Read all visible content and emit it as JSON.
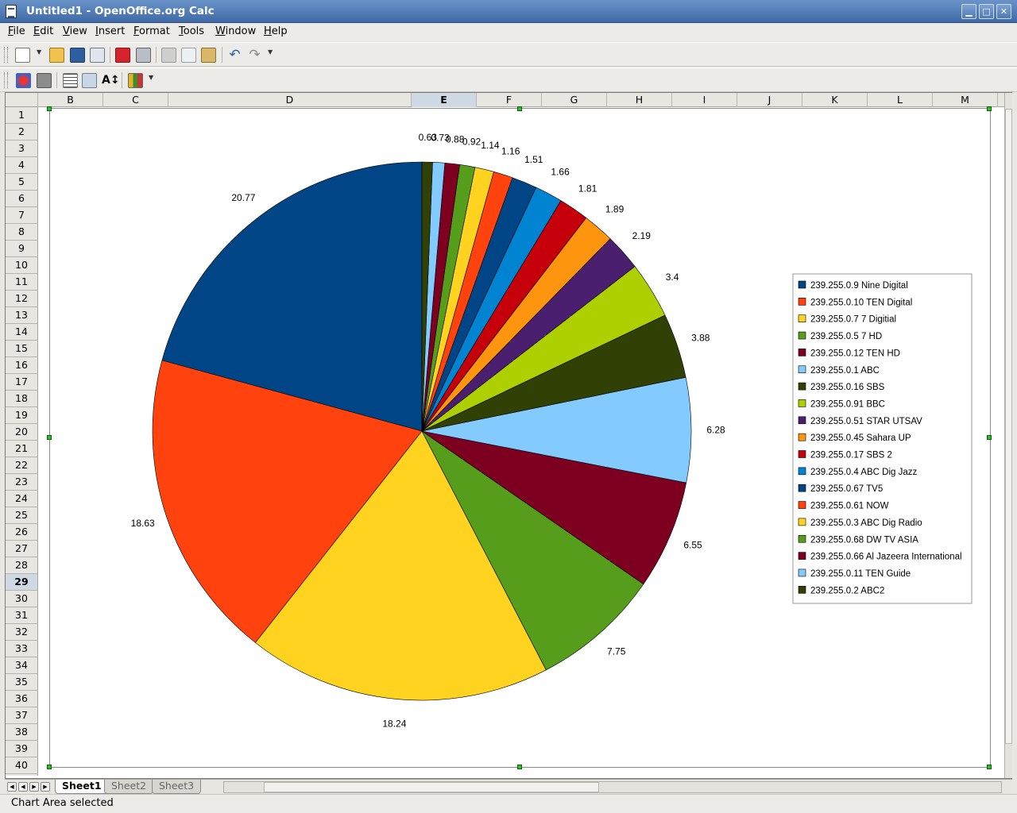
{
  "window": {
    "title": "Untitled1 - OpenOffice.org Calc",
    "minimize_glyph": "▁",
    "maximize_glyph": "□",
    "close_glyph": "✕"
  },
  "menu": [
    "File",
    "Edit",
    "View",
    "Insert",
    "Format",
    "Tools",
    "Window",
    "Help"
  ],
  "toolbar1_icons": [
    "new-document-icon",
    "open-folder-icon",
    "save-icon",
    "email-icon",
    "export-pdf-icon",
    "print-icon",
    "cut-icon",
    "copy-icon",
    "paste-icon",
    "undo-icon",
    "redo-icon"
  ],
  "toolbar2_icons": [
    "chart-color-icon",
    "chart-wall-icon",
    "grid-icon",
    "legend-icon",
    "scale-text-icon",
    "chart-type-icon"
  ],
  "columns": [
    "B",
    "C",
    "D",
    "E",
    "F",
    "G",
    "H",
    "I",
    "J",
    "K",
    "L",
    "M"
  ],
  "active_column": "E",
  "rows": [
    "1",
    "2",
    "3",
    "4",
    "5",
    "6",
    "7",
    "8",
    "9",
    "10",
    "11",
    "12",
    "13",
    "14",
    "15",
    "16",
    "17",
    "18",
    "19",
    "20",
    "21",
    "22",
    "23",
    "24",
    "25",
    "26",
    "27",
    "28",
    "29",
    "30",
    "31",
    "32",
    "33",
    "34",
    "35",
    "36",
    "37",
    "38",
    "39",
    "40"
  ],
  "active_row": "29",
  "sheet_tabs": [
    "Sheet1",
    "Sheet2",
    "Sheet3"
  ],
  "active_sheet": "Sheet1",
  "status": {
    "text": "Chart Area selected"
  },
  "chart_data": {
    "type": "pie",
    "title": "",
    "legend_position": "right",
    "start_angle_deg": 0,
    "direction": "counterclockwise",
    "slices": [
      {
        "label": "239.255.0.9  Nine Digital",
        "value": 20.77,
        "color": "#004586"
      },
      {
        "label": "239.255.0.10  TEN Digital",
        "value": 18.63,
        "color": "#ff420e"
      },
      {
        "label": "239.255.0.7  7 Digitial",
        "value": 18.24,
        "color": "#ffd320"
      },
      {
        "label": "239.255.0.5  7 HD",
        "value": 7.75,
        "color": "#579d1c"
      },
      {
        "label": "239.255.0.12  TEN HD",
        "value": 6.55,
        "color": "#7e0021"
      },
      {
        "label": "239.255.0.1  ABC",
        "value": 6.28,
        "color": "#83caff"
      },
      {
        "label": "239.255.0.16  SBS",
        "value": 3.88,
        "color": "#314004"
      },
      {
        "label": "239.255.0.91  BBC",
        "value": 3.4,
        "color": "#aecf00"
      },
      {
        "label": "239.255.0.51  STAR UTSAV",
        "value": 2.19,
        "color": "#4b1f6f"
      },
      {
        "label": "239.255.0.45  Sahara UP",
        "value": 1.89,
        "color": "#ff950e"
      },
      {
        "label": "239.255.0.17  SBS 2",
        "value": 1.81,
        "color": "#c5000b"
      },
      {
        "label": "239.255.0.4  ABC Dig Jazz",
        "value": 1.66,
        "color": "#0084d1"
      },
      {
        "label": "239.255.0.67  TV5",
        "value": 1.51,
        "color": "#004586"
      },
      {
        "label": "239.255.0.61  NOW",
        "value": 1.16,
        "color": "#ff420e"
      },
      {
        "label": "239.255.0.3  ABC Dig Radio",
        "value": 1.14,
        "color": "#ffd320"
      },
      {
        "label": "239.255.0.68  DW TV ASIA",
        "value": 0.92,
        "color": "#579d1c"
      },
      {
        "label": "239.255.0.66  Al Jazeera International",
        "value": 0.88,
        "color": "#7e0021"
      },
      {
        "label": "239.255.0.11  TEN Guide",
        "value": 0.73,
        "color": "#83caff"
      },
      {
        "label": "239.255.0.2  ABC2",
        "value": 0.63,
        "color": "#314004"
      }
    ]
  }
}
